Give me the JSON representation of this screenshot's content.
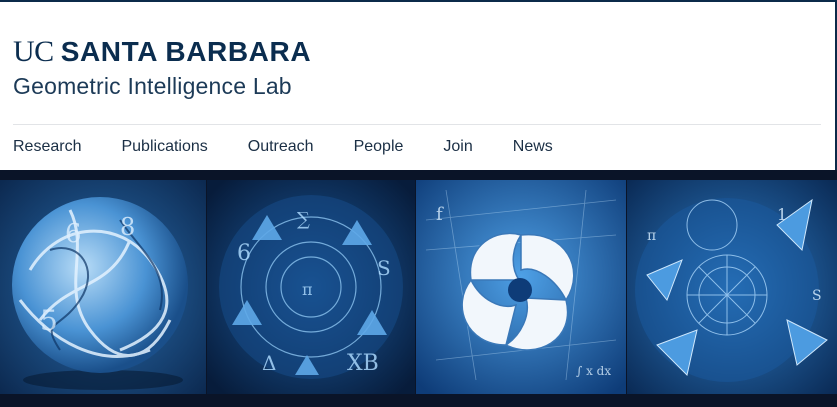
{
  "brand": {
    "uc": "UC",
    "santa_barbara": "SANTA BARBARA",
    "lab_name": "Geometric Intelligence Lab"
  },
  "nav": [
    {
      "label": "Research"
    },
    {
      "label": "Publications"
    },
    {
      "label": "Outreach"
    },
    {
      "label": "People"
    },
    {
      "label": "Join"
    },
    {
      "label": "News"
    }
  ],
  "colors": {
    "brand_navy": "#0b2d4f",
    "gallery_bg": "#0a1428",
    "art_blue": "#3a8fd8"
  },
  "gallery": [
    {
      "icon": "geometric-artwork-sphere"
    },
    {
      "icon": "geometric-artwork-symbols"
    },
    {
      "icon": "geometric-artwork-spiral"
    },
    {
      "icon": "geometric-artwork-polyhedra"
    }
  ]
}
